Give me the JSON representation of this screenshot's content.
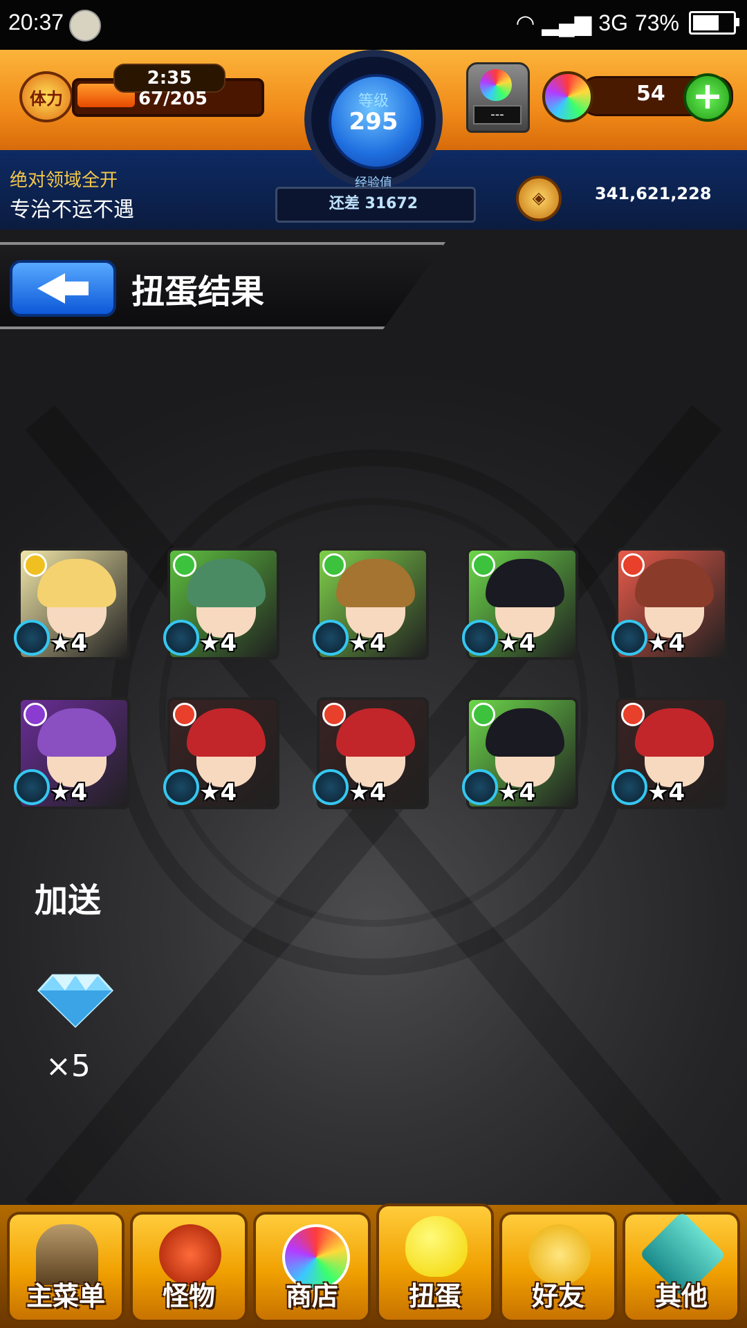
{
  "status_bar": {
    "time": "20:37",
    "network": "3G",
    "battery": "73%",
    "battery_level": 0.73
  },
  "hud": {
    "stamina_icon_label": "体力",
    "stamina_timer": "2:35",
    "stamina": "67/205",
    "stamina_fraction": 0.327,
    "level_label": "等级",
    "level": "295",
    "exp_label": "经验值",
    "exp_remaining": "还差 31672",
    "gacha_machine_display": "---",
    "orb_count": "54",
    "add_label": "+",
    "title_line1": "绝对领域全开",
    "title_line2": "专治不运不遇",
    "gold": "341,621,228"
  },
  "header": {
    "title": "扭蛋结果"
  },
  "results": [
    {
      "stars": "★4",
      "element": "light",
      "hair": "#f4d270",
      "bg": "#f1e6a8"
    },
    {
      "stars": "★4",
      "element": "wood",
      "hair": "#4a8b63",
      "bg": "#5dbf3f"
    },
    {
      "stars": "★4",
      "element": "wood",
      "hair": "#a57430",
      "bg": "#7fd04a"
    },
    {
      "stars": "★4",
      "element": "wood",
      "hair": "#1a1a22",
      "bg": "#6cd74a"
    },
    {
      "stars": "★4",
      "element": "fire",
      "hair": "#8a3b2a",
      "bg": "#e85a4a"
    },
    {
      "stars": "★4",
      "element": "dark",
      "hair": "#8a4fc0",
      "bg": "#6a2d98"
    },
    {
      "stars": "★4",
      "element": "fire",
      "hair": "#c2262a",
      "bg": "#3a2222"
    },
    {
      "stars": "★4",
      "element": "fire",
      "hair": "#c2262a",
      "bg": "#3a2222"
    },
    {
      "stars": "★4",
      "element": "wood",
      "hair": "#1a1a22",
      "bg": "#6cd74a"
    },
    {
      "stars": "★4",
      "element": "fire",
      "hair": "#c2262a",
      "bg": "#3a2222"
    }
  ],
  "bonus": {
    "label": "加送",
    "count": "×5",
    "icon": "diamond-icon"
  },
  "nav": [
    {
      "label": "主菜单",
      "icon": "gate-icon"
    },
    {
      "label": "怪物",
      "icon": "dragon-icon"
    },
    {
      "label": "商店",
      "icon": "rainbow-orb-icon"
    },
    {
      "label": "扭蛋",
      "icon": "egg-icon"
    },
    {
      "label": "好友",
      "icon": "friends-icon"
    },
    {
      "label": "其他",
      "icon": "question-icon"
    }
  ],
  "colors": {
    "accent": "#f18b1a",
    "hud_blue": "#0b1c40",
    "level_blue": "#1f6fe0",
    "nav_gold": "#f0a000"
  }
}
